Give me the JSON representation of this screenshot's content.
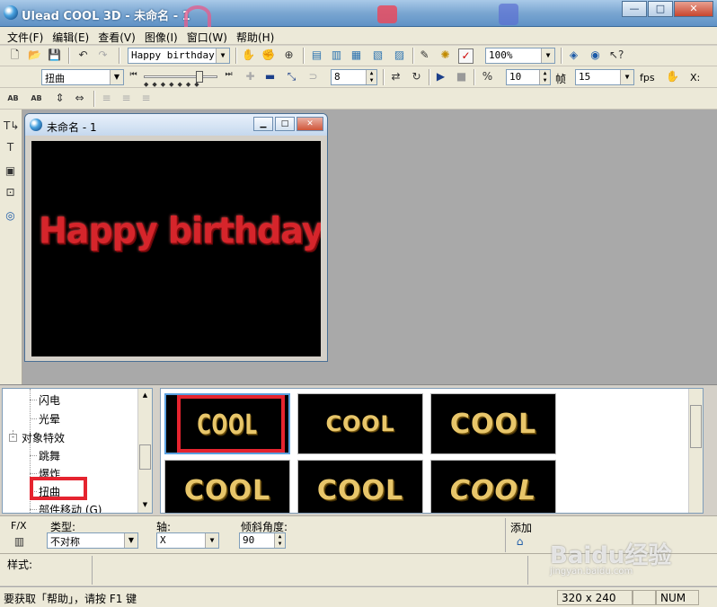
{
  "window": {
    "title": "Ulead COOL 3D - 未命名 - 1",
    "buttons": {
      "minimize": "—",
      "maximize": "□",
      "close": "✕"
    }
  },
  "menu": [
    "文件(F)",
    "编辑(E)",
    "查看(V)",
    "图像(I)",
    "窗口(W)",
    "帮助(H)"
  ],
  "toolbar1": {
    "object_combo": "Happy birthday",
    "zoom_combo": "100%"
  },
  "toolbar2": {
    "effect_combo": "扭曲",
    "frame_value": "8",
    "frames_value": "10",
    "frames_label": "帧",
    "fps_value": "15",
    "fps_label": "fps",
    "x_label": "X:"
  },
  "toolbar3": {
    "text_b1": "AB",
    "text_b2": "AB"
  },
  "document": {
    "title": "未命名 - 1",
    "canvas_text": "Happy birthday",
    "canvas_bg": "#000000",
    "text_color": "#d6252b"
  },
  "effects_tree": {
    "items": [
      {
        "label": "闪电",
        "level": 2
      },
      {
        "label": "光晕",
        "level": 2
      },
      {
        "label": "对象特效",
        "level": 1,
        "expander": "-"
      },
      {
        "label": "跳舞",
        "level": 2
      },
      {
        "label": "爆炸",
        "level": 2
      },
      {
        "label": "扭曲",
        "level": 2
      },
      {
        "label": "部件移动 (G)",
        "level": 2
      }
    ]
  },
  "gallery": {
    "thumbs": [
      {
        "text": "COOL",
        "selected": true
      },
      {
        "text": "COOL",
        "selected": false
      },
      {
        "text": "COOL",
        "selected": false
      },
      {
        "text": "COOL",
        "selected": false
      },
      {
        "text": "COOL",
        "selected": false
      },
      {
        "text": "COOL",
        "selected": false
      }
    ],
    "thumb_text_color": "#e8c66a"
  },
  "attributes": {
    "fx_label": "F/X",
    "type_label": "类型:",
    "type_value": "不对称",
    "axis_label": "轴:",
    "axis_value": "X",
    "angle_label": "倾斜角度:",
    "angle_value": "90",
    "add_label": "添加"
  },
  "style_panel": {
    "label": "样式:"
  },
  "status": {
    "help_text": "要获取「帮助」，请按 F1 键",
    "size": "320 x 240",
    "num": "NUM"
  },
  "watermark": {
    "text": "Baidu经验",
    "sub": "jingyan.baidu.com"
  },
  "highlight_color": "#e5242f"
}
